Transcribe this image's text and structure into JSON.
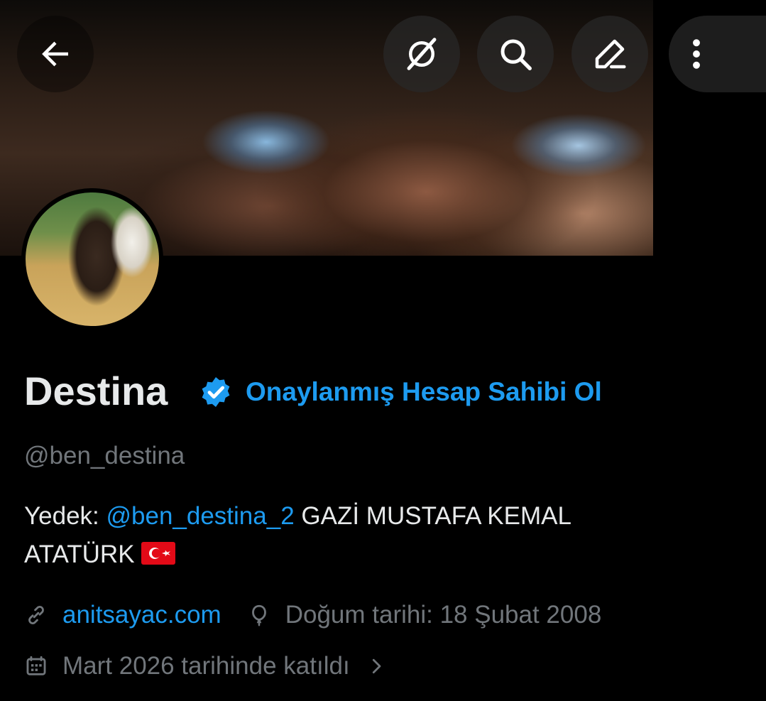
{
  "header": {
    "back_icon": "arrow-left-icon",
    "actions": [
      {
        "name": "grok-icon"
      },
      {
        "name": "search-icon"
      },
      {
        "name": "edit-icon"
      },
      {
        "name": "more-vertical-icon"
      }
    ]
  },
  "profile": {
    "display_name": "Destina",
    "verified_badge_color": "#1d9bf0",
    "verify_cta": "Onaylanmış Hesap Sahibi Ol",
    "handle": "@ben_destina",
    "bio": {
      "prefix": "Yedek: ",
      "mention": "@ben_destina_2",
      "text_after_mention": " GAZİ MUSTAFA KEMAL",
      "line2": "ATATÜRK "
    },
    "website": "anitsayac.com",
    "birthday": "Doğum tarihi: 18 Şubat 2008",
    "joined": "Mart 2026 tarihinde katıldı"
  },
  "colors": {
    "accent": "#1d9bf0",
    "muted": "#71767b",
    "text": "#e7e9ea",
    "background": "#000000"
  }
}
